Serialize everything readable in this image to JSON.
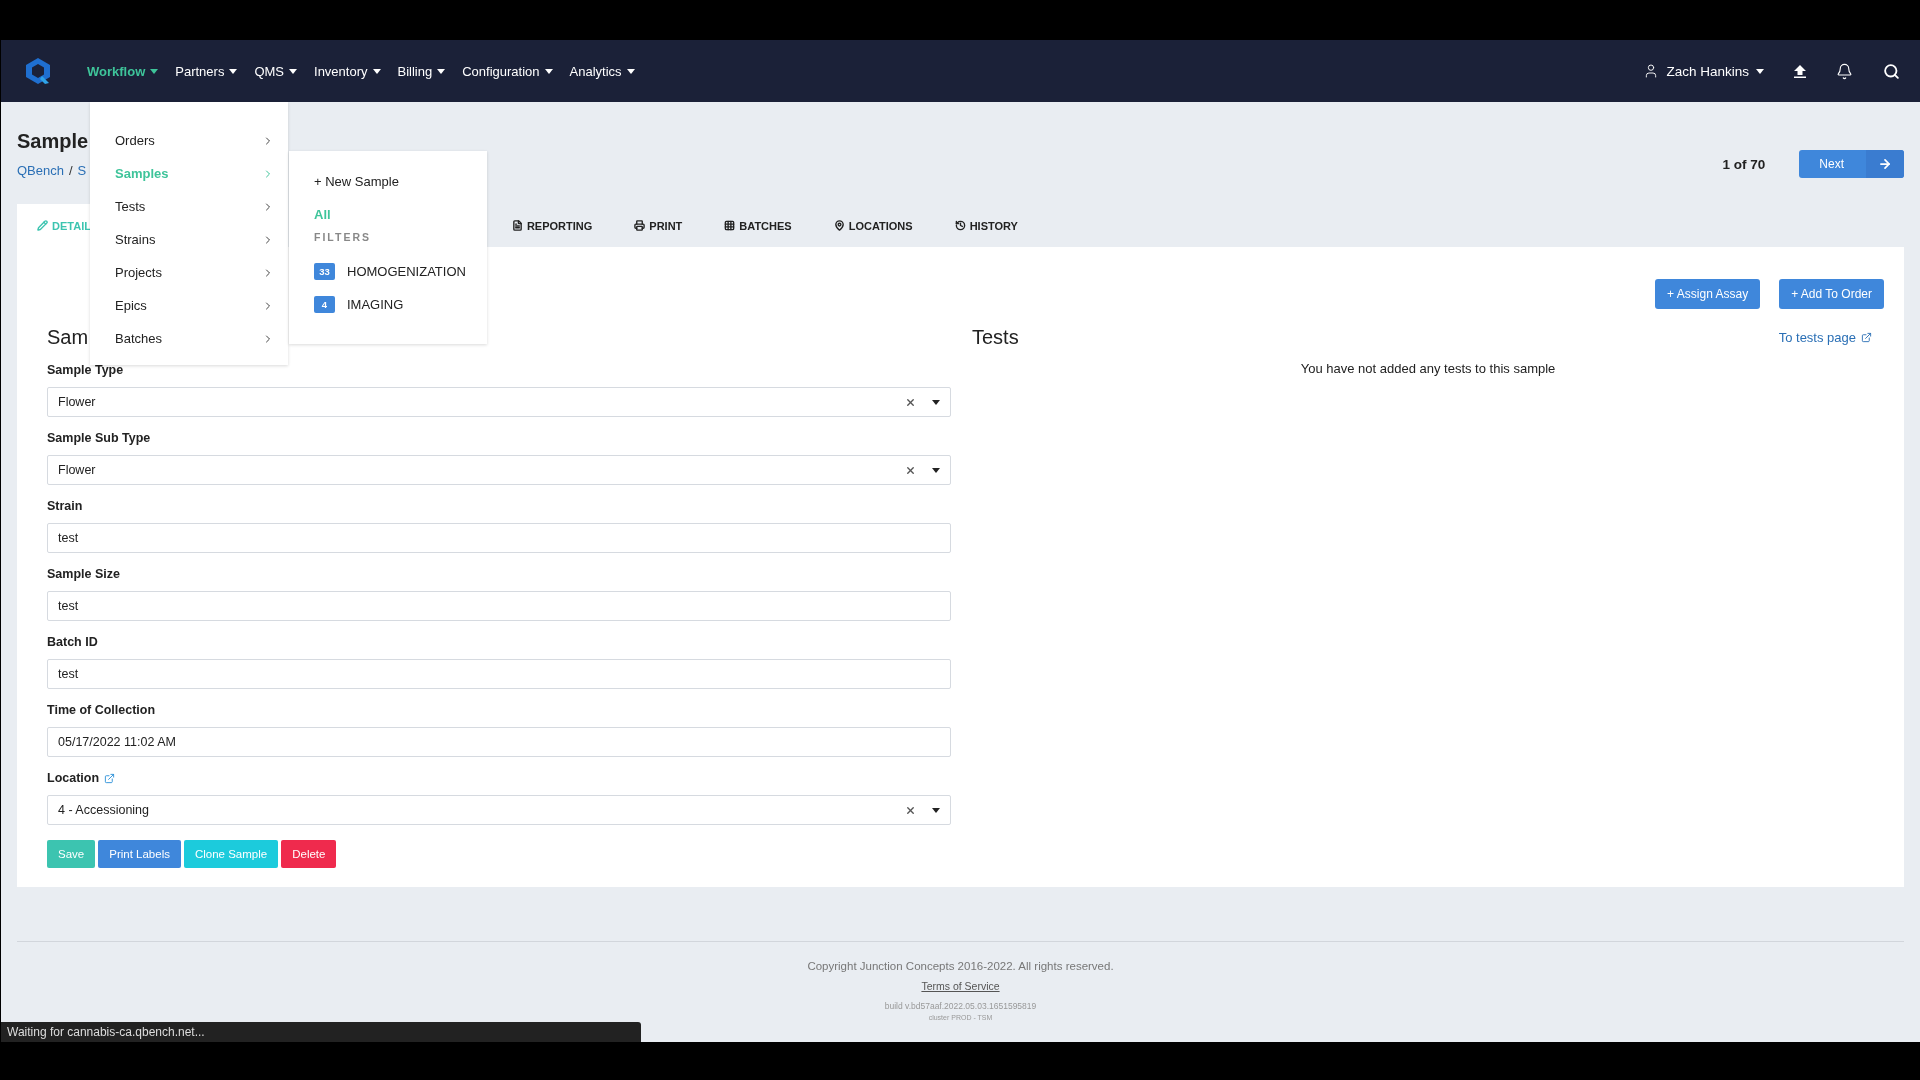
{
  "nav": {
    "items": [
      {
        "label": "Workflow",
        "selected": true
      },
      {
        "label": "Partners",
        "selected": false
      },
      {
        "label": "QMS",
        "selected": false
      },
      {
        "label": "Inventory",
        "selected": false
      },
      {
        "label": "Billing",
        "selected": false
      },
      {
        "label": "Configuration",
        "selected": false
      },
      {
        "label": "Analytics",
        "selected": false
      }
    ],
    "user": "Zach Hankins"
  },
  "menu": {
    "items": [
      {
        "label": "Orders",
        "selected": false
      },
      {
        "label": "Samples",
        "selected": true
      },
      {
        "label": "Tests",
        "selected": false
      },
      {
        "label": "Strains",
        "selected": false
      },
      {
        "label": "Projects",
        "selected": false
      },
      {
        "label": "Epics",
        "selected": false
      },
      {
        "label": "Batches",
        "selected": false
      }
    ],
    "submenu": {
      "links": [
        {
          "label": "+ New Sample",
          "selected": false
        },
        {
          "label": "All",
          "selected": true
        }
      ],
      "filters_heading": "FILTERS",
      "filters": [
        {
          "count": "33",
          "label": "HOMOGENIZATION"
        },
        {
          "count": "4",
          "label": "IMAGING"
        }
      ]
    }
  },
  "page": {
    "title": "Sample",
    "breadcrumb": [
      "QBench",
      "S"
    ],
    "breadcrumb_separator": "/",
    "pager": "1 of 70",
    "next_button": "Next"
  },
  "tabs": [
    {
      "label": "DETAIL",
      "selected": true
    },
    {
      "label": "REPORTING",
      "selected": false
    },
    {
      "label": "PRINT",
      "selected": false
    },
    {
      "label": "BATCHES",
      "selected": false
    },
    {
      "label": "LOCATIONS",
      "selected": false
    },
    {
      "label": "HISTORY",
      "selected": false
    }
  ],
  "sample_section": {
    "heading": "Sam",
    "fields": [
      {
        "label": "Sample Type",
        "kind": "select",
        "value": "Flower",
        "external_link": false
      },
      {
        "label": "Sample Sub Type",
        "kind": "select",
        "value": "Flower",
        "external_link": false
      },
      {
        "label": "Strain",
        "kind": "text",
        "value": "test",
        "external_link": false
      },
      {
        "label": "Sample Size",
        "kind": "text",
        "value": "test",
        "external_link": false
      },
      {
        "label": "Batch ID",
        "kind": "text",
        "value": "test",
        "external_link": false
      },
      {
        "label": "Time of Collection",
        "kind": "text",
        "value": "05/17/2022 11:02 AM",
        "external_link": false
      },
      {
        "label": "Location",
        "kind": "select",
        "value": "4 - Accessioning",
        "external_link": true
      }
    ],
    "actions": [
      {
        "label": "Save",
        "color": "#3cc4b0"
      },
      {
        "label": "Print Labels",
        "color": "#3f87db"
      },
      {
        "label": "Clone Sample",
        "color": "#1ccbdc"
      },
      {
        "label": "Delete",
        "color": "#ef2a4d"
      }
    ]
  },
  "tests": {
    "heading": "Tests",
    "buttons": [
      "+ Assign Assay",
      "+ Add To Order"
    ],
    "link": "To tests page",
    "empty_message": "You have not added any tests to this sample"
  },
  "footer": {
    "copyright": "Copyright Junction Concepts 2016-2022. All rights reserved.",
    "terms": "Terms of Service",
    "build": "build v.bd57aaf.2022.05.03.1651595819",
    "cluster": "cluster PROD - TSM"
  },
  "status_bar": "Waiting for cannabis-ca.qbench.net..."
}
